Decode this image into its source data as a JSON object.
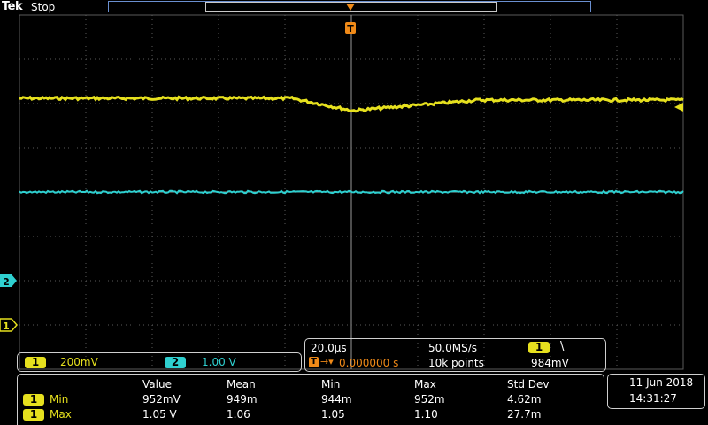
{
  "header": {
    "brand": "Tek",
    "status": "Stop"
  },
  "colors": {
    "ch1": "#e6e01e",
    "ch2": "#2fd0d0",
    "trigger": "#f08a18",
    "grid": "#5a5a5a"
  },
  "markers": {
    "trigger_label": "T",
    "ch2_marker": "2",
    "ch1_marker": "1"
  },
  "channels": [
    {
      "number": "1",
      "scale": "200mV"
    },
    {
      "number": "2",
      "scale": "1.00 V"
    }
  ],
  "horizontal": {
    "timebase": "20.0µs",
    "sample_rate": "50.0MS/s",
    "trigger_channel": "1",
    "trigger_slope_symbol": "\\",
    "trigger_position": "0.000000 s",
    "record_length": "10k points",
    "trigger_level": "984mV"
  },
  "measurements": {
    "headers": [
      "Value",
      "Mean",
      "Min",
      "Max",
      "Std Dev"
    ],
    "rows": [
      {
        "channel": "1",
        "name": "Min",
        "values": [
          "952mV",
          "949m",
          "944m",
          "952m",
          "4.62m"
        ]
      },
      {
        "channel": "1",
        "name": "Max",
        "values": [
          "1.05 V",
          "1.06",
          "1.05",
          "1.10",
          "27.7m"
        ]
      }
    ]
  },
  "datetime": {
    "date": "11 Jun  2018",
    "time": "14:31:27"
  }
}
